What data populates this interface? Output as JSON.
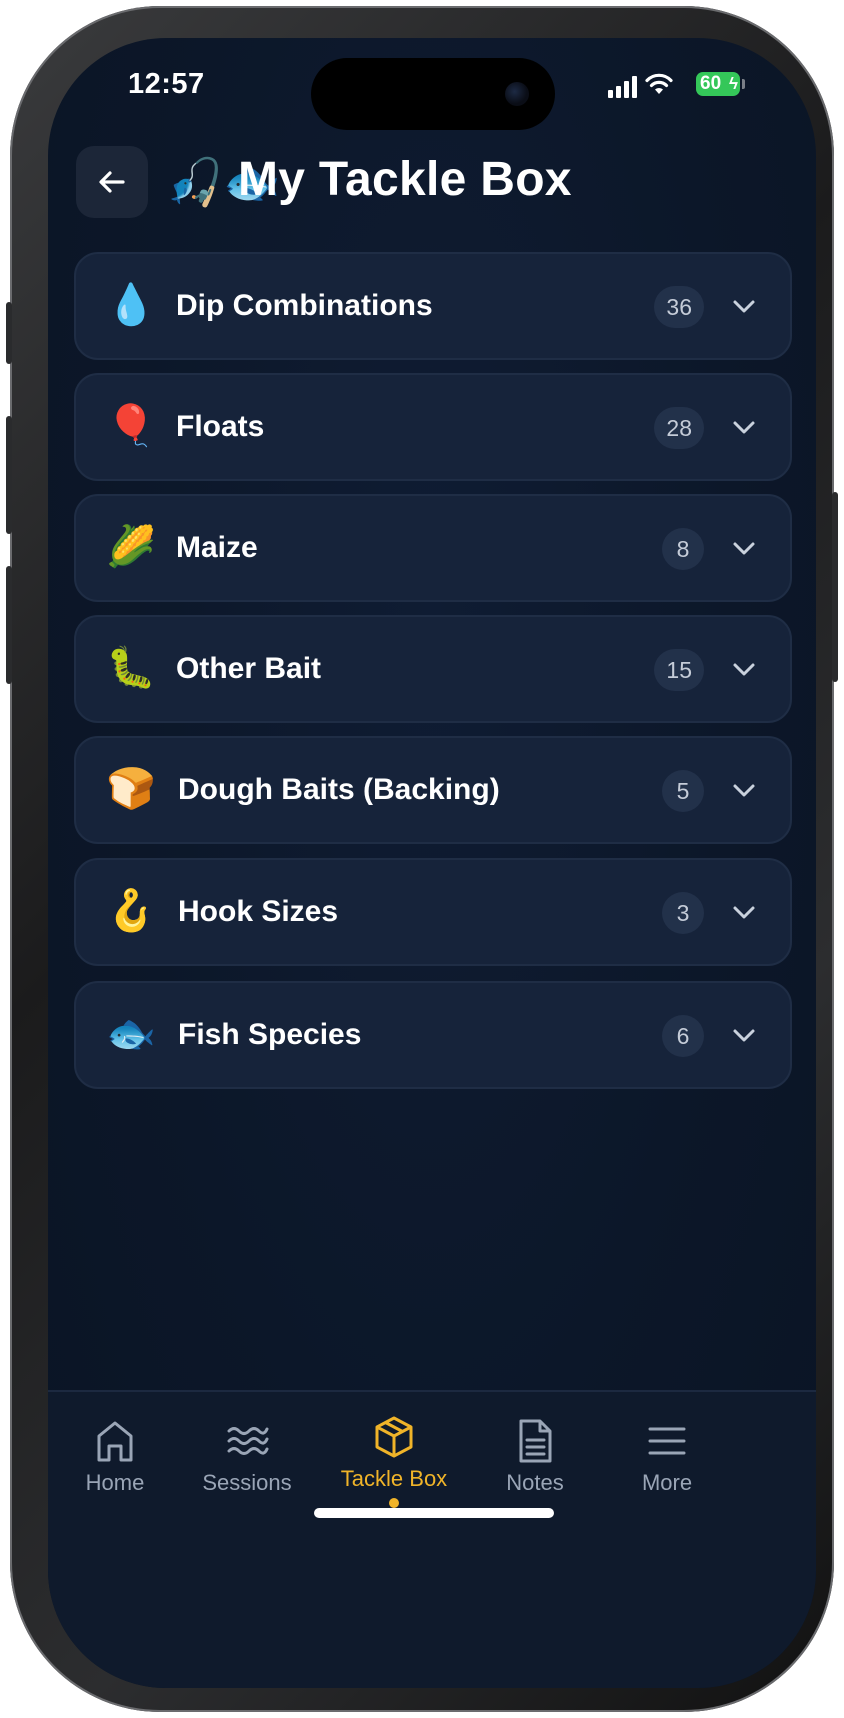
{
  "status_bar": {
    "time": "12:57",
    "battery_level": "60"
  },
  "header": {
    "back_icon": "arrow-left-icon",
    "title_emoji": "🎣🐟",
    "title": "My Tackle Box"
  },
  "categories": [
    {
      "emoji": "💧",
      "label": "Dip Combinations",
      "count": "36"
    },
    {
      "emoji": "🎈",
      "label": "Floats",
      "count": "28"
    },
    {
      "emoji": "🌽",
      "label": "Maize",
      "count": "8"
    },
    {
      "emoji": "🐛",
      "label": "Other Bait",
      "count": "15"
    },
    {
      "emoji": "🍞",
      "label": "Dough Baits (Backing)",
      "count": "5"
    },
    {
      "emoji": "🪝",
      "label": "Hook Sizes",
      "count": "3"
    },
    {
      "emoji": "🐟",
      "label": "Fish Species",
      "count": "6"
    }
  ],
  "tabbar": {
    "tabs": [
      {
        "icon": "home-icon",
        "label": "Home"
      },
      {
        "icon": "waves-icon",
        "label": "Sessions"
      },
      {
        "icon": "box-icon",
        "label": "Tackle Box",
        "active": true
      },
      {
        "icon": "document-icon",
        "label": "Notes"
      },
      {
        "icon": "menu-icon",
        "label": "More"
      }
    ]
  },
  "colors": {
    "background": "#0c1729",
    "card": "#16233a",
    "accent": "#f0b429",
    "battery": "#34c759"
  }
}
